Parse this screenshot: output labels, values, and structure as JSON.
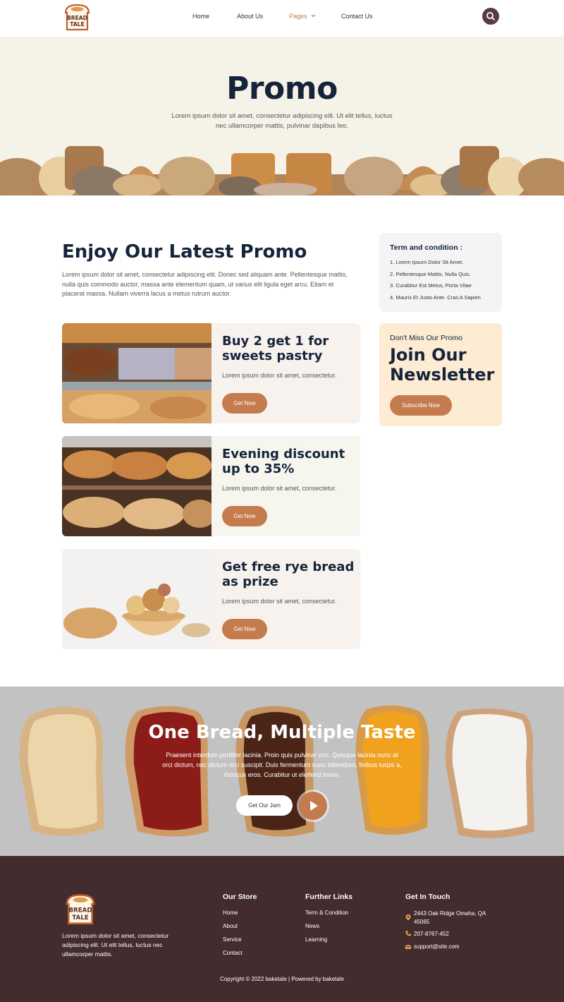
{
  "header": {
    "logo": {
      "line1": "BREAD",
      "line2": "TALE"
    },
    "nav": [
      "Home",
      "About Us",
      "Pages",
      "Contact Us"
    ],
    "active_nav": "Pages",
    "search_icon": "search-icon"
  },
  "hero": {
    "title": "Promo",
    "subtitle": "Lorem ipsum dolor sit amet, consectetur adipiscing elit. Ut elit tellus, luctus nec ullamcorper mattis, pulvinar dapibus leo."
  },
  "promo_section": {
    "title": "Enjoy Our Latest Promo",
    "description": "Lorem ipsum dolor sit amet, consectetur adipiscing elit. Donec sed aliquam ante. Pellentesque mattis, nulla quis commodo auctor, massa ante elementum quam, ut varius elit ligula eget arcu. Etiam et placerat massa. Nullam viverra lacus a metus rutrum auctor.",
    "cards": [
      {
        "title": "Buy 2 get 1 for sweets pastry",
        "text": "Lorem ipsum dolor sit amet, consectetur.",
        "button": "Get Now"
      },
      {
        "title": "Evening discount up to 35%",
        "text": "Lorem ipsum dolor sit amet, consectetur.",
        "button": "Get Now"
      },
      {
        "title": "Get free rye bread as prize",
        "text": "Lorem ipsum dolor sit amet, consectetur.",
        "button": "Get Now"
      }
    ]
  },
  "terms": {
    "title": "Term and condition :",
    "items": [
      "1. Lorem Ipsum Dolor Sit Amet.",
      "2. Pellentesque Mattis, Nulla Quis.",
      "3. Curabitur Est Metus, Porta Vitae",
      "4. Mauris Et Justo Ante. Cras A Sapien"
    ]
  },
  "newsletter": {
    "pretitle": "Don't Miss Our Promo",
    "title": "Join Our Newsletter",
    "button": "Subscribe Now"
  },
  "taste": {
    "title": "One Bread, Multiple Taste",
    "subtitle": "Praesent interdum porttitor lacinia. Proin quis pulvinar orci. Quisque lacinia nunc at orci dictum, nec dictum orci suscipit. Duis fermentum nunc bibendum, finibus turpis a, rhoncus eros. Curabitur ut eleifend lorem.",
    "button": "Get Our Jam",
    "play_icon": "play-icon"
  },
  "footer": {
    "about": "Lorem ipsum dolor sit amet, consectetur adipiscing elit. Ut elit tellus, luctus nec ullamcorper mattis.",
    "store": {
      "title": "Our Store",
      "links": [
        "Home",
        "About",
        "Service",
        "Contact"
      ]
    },
    "further": {
      "title": "Further Links",
      "links": [
        "Term & Condition",
        "News",
        "Learning"
      ]
    },
    "touch": {
      "title": "Get In Touch",
      "address": "2443 Oak Ridge Omaha, QA 45065",
      "phone": "207-8767-452",
      "email": "support@site.com"
    },
    "copyright": "Copyright © 2022 baketale | Powered by baketale"
  },
  "colors": {
    "accent": "#c47b4e",
    "dark": "#15243a",
    "footer": "#432c2d",
    "newsletter_bg": "#fdebd3"
  }
}
